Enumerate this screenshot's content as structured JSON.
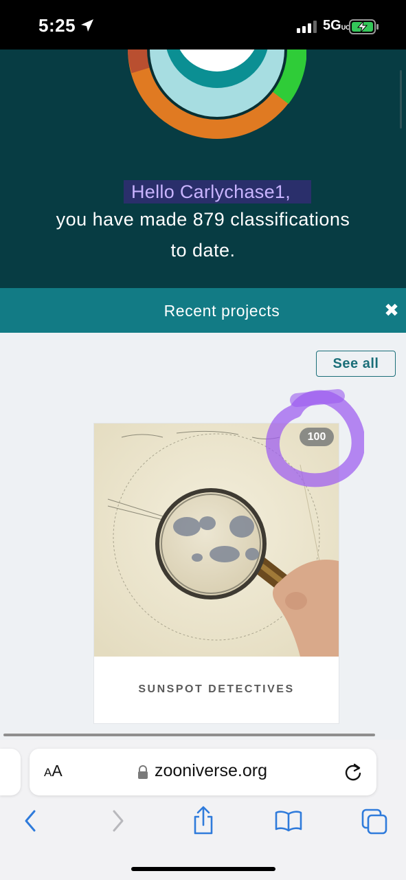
{
  "status_bar": {
    "time": "5:25",
    "network": "5G",
    "network_suffix": "UC"
  },
  "hero": {
    "greeting": "Hello Carlychase1,",
    "count_line1": "you have made 879 classifications",
    "count_line2": "to date."
  },
  "recent": {
    "title": "Recent projects",
    "close_symbol": "✖",
    "see_all": "See all"
  },
  "project": {
    "name": "SUNSPOT DETECTIVES",
    "badge": "100"
  },
  "browser": {
    "aa_small": "A",
    "aa_large": "A",
    "url": "zooniverse.org"
  },
  "colors": {
    "hero_bg": "#073c43",
    "bar_bg": "#127b85",
    "greeting_text": "#c9b4ff",
    "ios_blue": "#2f7bdb"
  },
  "icons": {
    "location": "location-arrow-icon",
    "signal": "cellular-signal-icon",
    "battery": "battery-charging-icon",
    "close": "close-icon",
    "lock": "lock-icon",
    "reload": "reload-icon",
    "back": "back-chevron-icon",
    "forward": "forward-chevron-icon",
    "share": "share-icon",
    "bookmarks": "bookmarks-icon",
    "tabs": "tabs-icon"
  }
}
